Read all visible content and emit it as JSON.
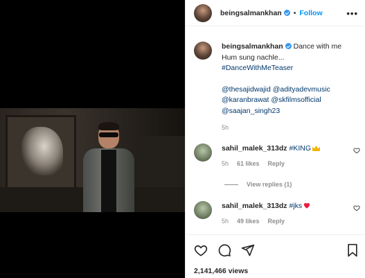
{
  "account": {
    "username": "beingsalmankhan",
    "follow_label": "Follow",
    "separator": "•",
    "more_label": "•••"
  },
  "caption": {
    "username": "beingsalmankhan",
    "line1": "Dance with me",
    "line2": "Hum sung nachle...",
    "line3": "#DanceWithMeTeaser",
    "mentions": [
      "@thesajidwajid @adityadevmusic",
      "@karanbrawat @skfilmsofficial",
      "@saajan_singh23"
    ],
    "time": "5h"
  },
  "comments": [
    {
      "username": "sahil_malek_313dz",
      "text": "#KING",
      "emoji": "crown-icon",
      "time": "5h",
      "likes": "61 likes",
      "reply_label": "Reply"
    },
    {
      "username": "sahil_malek_313dz",
      "text": "#jks",
      "emoji": "heart-icon",
      "time": "5h",
      "likes": "49 likes",
      "reply_label": "Reply"
    }
  ],
  "view_replies_label": "View replies (1)",
  "views": "2,141,466 views",
  "colors": {
    "link_blue": "#0095f6",
    "verified_blue": "#3897f0",
    "hashtag": "#00376b",
    "muted": "#8e8e8e",
    "crown": "#f5b400",
    "heart_red": "#ed1c3a"
  }
}
